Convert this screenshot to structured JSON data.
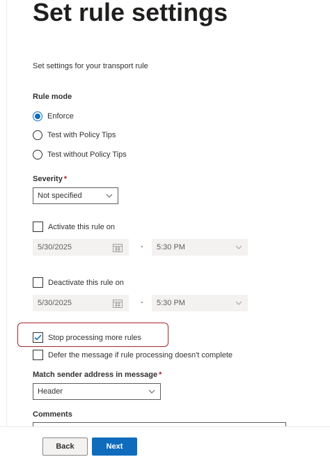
{
  "header": {
    "title": "Set rule settings",
    "subtitle": "Set settings for your transport rule"
  },
  "rule_mode": {
    "label": "Rule mode",
    "options": [
      {
        "label": "Enforce",
        "selected": true
      },
      {
        "label": "Test with Policy Tips",
        "selected": false
      },
      {
        "label": "Test without Policy Tips",
        "selected": false
      }
    ]
  },
  "severity": {
    "label": "Severity",
    "required_marker": "*",
    "value": "Not specified"
  },
  "activate": {
    "label": "Activate this rule on",
    "checked": false,
    "date": "5/30/2025",
    "separator": "-",
    "time": "5:30 PM"
  },
  "deactivate": {
    "label": "Deactivate this rule on",
    "checked": false,
    "date": "5/30/2025",
    "separator": "-",
    "time": "5:30 PM"
  },
  "stop_processing": {
    "label": "Stop processing more rules",
    "checked": true
  },
  "defer": {
    "label": "Defer the message if rule processing doesn't complete",
    "checked": false
  },
  "match_sender": {
    "label": "Match sender address in message",
    "required_marker": "*",
    "value": "Header"
  },
  "comments": {
    "label": "Comments",
    "value": ""
  },
  "footer": {
    "back_label": "Back",
    "next_label": "Next"
  },
  "colors": {
    "accent": "#0f6cbd",
    "highlight": "#a4262c",
    "disabled_bg": "#f3f2f1"
  }
}
